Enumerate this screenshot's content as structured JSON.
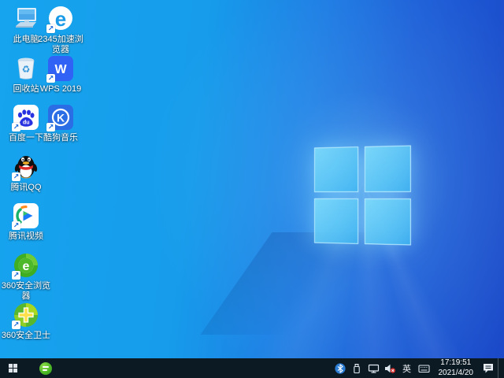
{
  "wallpaper": {
    "description": "Windows 10 default light-blue wallpaper with glowing window logo",
    "base_color_left": "#16a4ee",
    "base_color_right": "#1b48c8",
    "logo_pane_color": "#6fd0f6"
  },
  "desktop": {
    "icons": [
      {
        "label": "此电脑",
        "name": "this-pc",
        "shortcut": false
      },
      {
        "label": "2345加速浏览器",
        "name": "2345-browser",
        "shortcut": true
      },
      {
        "label": "回收站",
        "name": "recycle-bin",
        "shortcut": false
      },
      {
        "label": "WPS 2019",
        "name": "wps-2019",
        "shortcut": true
      },
      {
        "label": "百度一下",
        "name": "baidu",
        "shortcut": true
      },
      {
        "label": "酷狗音乐",
        "name": "kugou-music",
        "shortcut": true
      },
      {
        "label": "腾讯QQ",
        "name": "tencent-qq",
        "shortcut": true
      },
      {
        "label": "腾讯视频",
        "name": "tencent-video",
        "shortcut": true
      },
      {
        "label": "360安全浏览器",
        "name": "360-safe-browser",
        "shortcut": true
      },
      {
        "label": "360安全卫士",
        "name": "360-safe-guard",
        "shortcut": true
      }
    ]
  },
  "taskbar": {
    "background": "#0c1a24",
    "pinned": [
      {
        "name": "360-safe-browser"
      }
    ],
    "tray": {
      "icons": [
        "bluetooth",
        "usb-device",
        "display-network",
        "volume-muted",
        "ime",
        "touch-keyboard"
      ],
      "ime": "英",
      "time": "17:19:51",
      "date": "2021/4/20"
    }
  }
}
